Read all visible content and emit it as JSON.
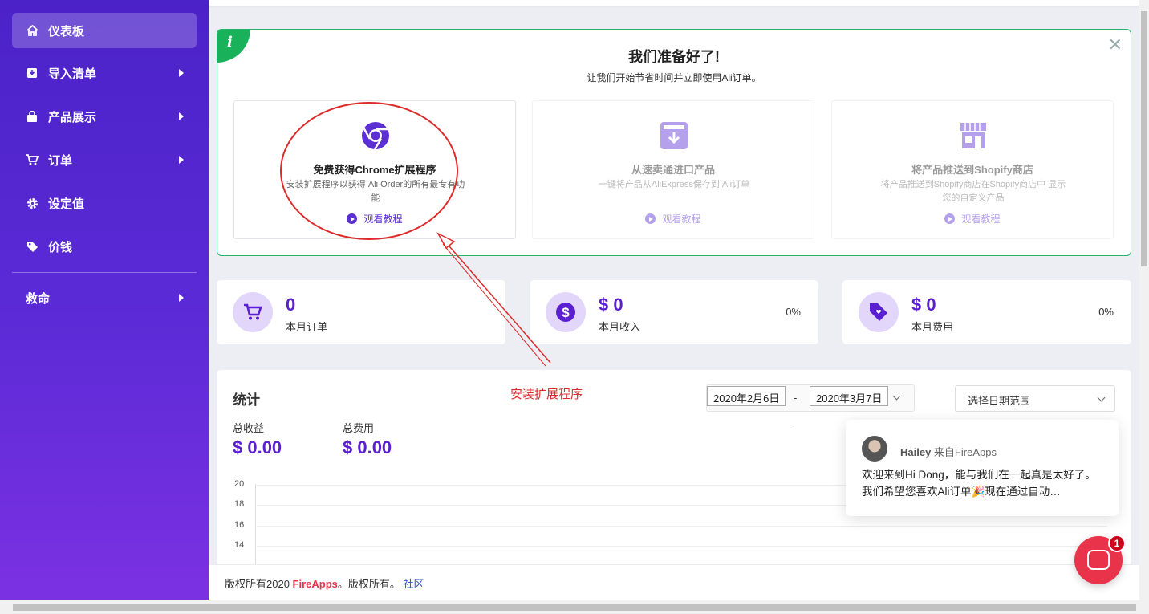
{
  "sidebar": {
    "items": [
      {
        "label": "仪表板",
        "icon": "home-icon"
      },
      {
        "label": "导入清单",
        "icon": "import-icon"
      },
      {
        "label": "产品展示",
        "icon": "bag-icon"
      },
      {
        "label": "订单",
        "icon": "cart-icon"
      },
      {
        "label": "设定值",
        "icon": "gear-icon"
      },
      {
        "label": "价钱",
        "icon": "tag-icon"
      },
      {
        "label": "救命",
        "icon": ""
      }
    ]
  },
  "welcome": {
    "title": "我们准备好了!",
    "subtitle": "让我们开始节省时间并立即使用Ali订单。",
    "steps": [
      {
        "title": "免费获得Chrome扩展程序",
        "desc": "安装扩展程序以获得 Ali Order的所有最专有功能",
        "watch": "观看教程",
        "icon": "chrome-icon"
      },
      {
        "title": "从速卖通进口产品",
        "desc": "一键将产品从AliExpress保存到 Ali订单",
        "watch": "观看教程",
        "icon": "download-box-icon"
      },
      {
        "title": "将产品推送到Shopify商店",
        "desc": "将产品推送到Shopify商店在Shopify商店中 显示您的自定义产品",
        "watch": "观看教程",
        "icon": "store-icon"
      }
    ]
  },
  "cards": [
    {
      "value": "0",
      "label": "本月订单",
      "pct": ""
    },
    {
      "value": "$ 0",
      "label": "本月收入",
      "pct": "0%"
    },
    {
      "value": "$ 0",
      "label": "本月费用",
      "pct": "0%"
    }
  ],
  "stats": {
    "title": "统计",
    "annotation": "安装扩展程序",
    "revenue_label": "总收益",
    "revenue_value": "$ 0.00",
    "cost_label": "总费用",
    "cost_value": "$ 0.00",
    "date_from": "2020年2月6日",
    "date_sep": "-",
    "date_to": "2020年3月7日",
    "range_placeholder": "选择日期范围",
    "dash": "-",
    "yticks": [
      "20",
      "18",
      "16",
      "14"
    ]
  },
  "footer": {
    "text": "版权所有2020 ",
    "brand": "FireApps",
    "text2": "。版权所有。 ",
    "link": "社区"
  },
  "chat": {
    "name": "Hailey",
    "from": " 来自FireApps",
    "message": "欢迎来到Hi Dong，能与我们在一起真是太好了。我们希望您喜欢Ali订单🎉现在通过自动…",
    "badge": "1"
  },
  "colors": {
    "accent": "#5a1fd1",
    "brand": "#e8334a",
    "success": "#19b25a",
    "annotation": "#dd2a2a"
  }
}
